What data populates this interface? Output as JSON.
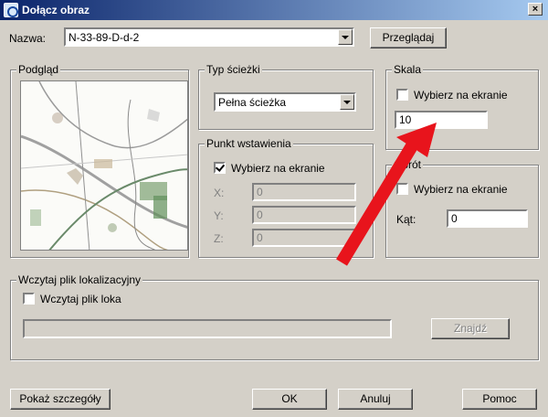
{
  "window": {
    "title": "Dołącz obraz",
    "close_glyph": "×"
  },
  "name_row": {
    "label": "Nazwa:",
    "value": "N-33-89-D-d-2",
    "browse_label": "Przeglądaj"
  },
  "preview_group": {
    "legend": "Podgląd"
  },
  "path_type": {
    "legend": "Typ ścieżki",
    "value": "Pełna ścieżka"
  },
  "insertion_point": {
    "legend": "Punkt wstawienia",
    "pick_label": "Wybierz na ekranie",
    "pick_checked": true,
    "x_label": "X:",
    "x_value": "0",
    "y_label": "Y:",
    "y_value": "0",
    "z_label": "Z:",
    "z_value": "0"
  },
  "scale": {
    "legend": "Skala",
    "pick_label": "Wybierz na ekranie",
    "pick_checked": false,
    "value": "10"
  },
  "rotation": {
    "legend": "Obrót",
    "pick_label": "Wybierz na ekranie",
    "pick_checked": false,
    "angle_label": "Kąt:",
    "angle_value": "0"
  },
  "location_file": {
    "legend": "Wczytaj plik lokalizacyjny",
    "check_label": "Wczytaj plik loka",
    "find_label": "Znajdź"
  },
  "footer": {
    "details_label": "Pokaż szczegóły",
    "ok_label": "OK",
    "cancel_label": "Anuluj",
    "help_label": "Pomoc"
  },
  "annotation": {
    "arrow_color": "#e8141c"
  },
  "colors": {
    "title_start": "#0a246a",
    "title_end": "#a6caf0",
    "dialog_bg": "#d4d0c8"
  }
}
